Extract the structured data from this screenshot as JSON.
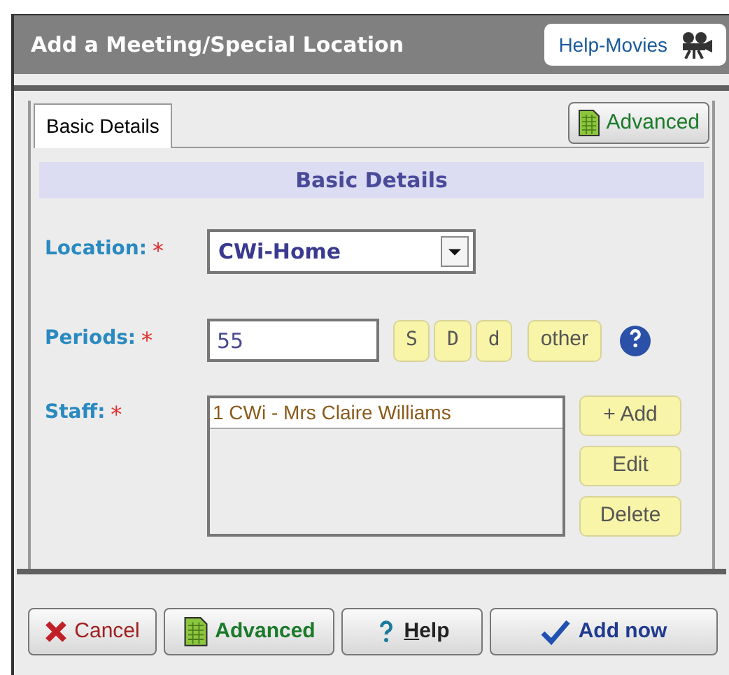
{
  "window": {
    "title": "Add a Meeting/Special Location",
    "help_button": "Help-Movies"
  },
  "tabs": [
    {
      "label": "Basic Details",
      "selected": true
    }
  ],
  "advanced_button": "Advanced",
  "section_title": "Basic Details",
  "location": {
    "label": "Location:",
    "required_mark": "*",
    "value": "CWi-Home"
  },
  "periods": {
    "label": "Periods:",
    "required_mark": "*",
    "value": "55",
    "shortcuts": [
      "S",
      "D",
      "d",
      "other"
    ]
  },
  "staff": {
    "label": "Staff:",
    "required_mark": "*",
    "items": [
      {
        "text": "1 CWi - Mrs Claire Williams",
        "selected": true
      }
    ],
    "buttons": [
      "+ Add",
      "Edit",
      "Delete"
    ]
  },
  "footer_buttons": [
    {
      "kind": "cancel",
      "label": "Cancel"
    },
    {
      "kind": "advanced",
      "label": "Advanced"
    },
    {
      "kind": "help",
      "label": "Help",
      "underline_first": true
    },
    {
      "kind": "add",
      "label": "Add now"
    }
  ]
}
